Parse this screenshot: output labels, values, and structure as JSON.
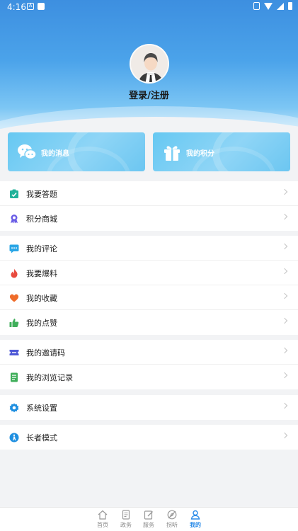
{
  "status_bar": {
    "time": "4:16"
  },
  "profile": {
    "login_label": "登录/注册"
  },
  "cards": [
    {
      "label": "我的消息",
      "icon": "chat-icon"
    },
    {
      "label": "我的积分",
      "icon": "gift-icon"
    }
  ],
  "groups": [
    [
      {
        "label": "我要答题",
        "icon": "quiz-icon",
        "color": "#20b29a"
      },
      {
        "label": "积分商城",
        "icon": "mall-icon",
        "color": "#6a5de6"
      }
    ],
    [
      {
        "label": "我的评论",
        "icon": "comment-icon",
        "color": "#2aa6e6"
      },
      {
        "label": "我要爆料",
        "icon": "fire-icon",
        "color": "#e84a3e"
      },
      {
        "label": "我的收藏",
        "icon": "heart-icon",
        "color": "#ef6c2a"
      },
      {
        "label": "我的点赞",
        "icon": "thumb-up-icon",
        "color": "#3fae5a"
      }
    ],
    [
      {
        "label": "我的邀请码",
        "icon": "ticket-icon",
        "color": "#4d57d6"
      },
      {
        "label": "我的浏览记录",
        "icon": "history-icon",
        "color": "#3fae5a"
      }
    ],
    [
      {
        "label": "系统设置",
        "icon": "settings-icon",
        "color": "#1f8fe0"
      }
    ],
    [
      {
        "label": "长者模式",
        "icon": "elder-mode-icon",
        "color": "#1f8fe0"
      }
    ]
  ],
  "tabs": [
    {
      "label": "首页",
      "icon": "home-icon",
      "active": false
    },
    {
      "label": "政务",
      "icon": "document-icon",
      "active": false
    },
    {
      "label": "服务",
      "icon": "edit-icon",
      "active": false
    },
    {
      "label": "拐听",
      "icon": "compass-icon",
      "active": false
    },
    {
      "label": "我的",
      "icon": "user-icon",
      "active": true
    }
  ],
  "colors": {
    "accent": "#2a8be8",
    "header_top": "#3d8fe0",
    "card": "#7ccff4"
  }
}
